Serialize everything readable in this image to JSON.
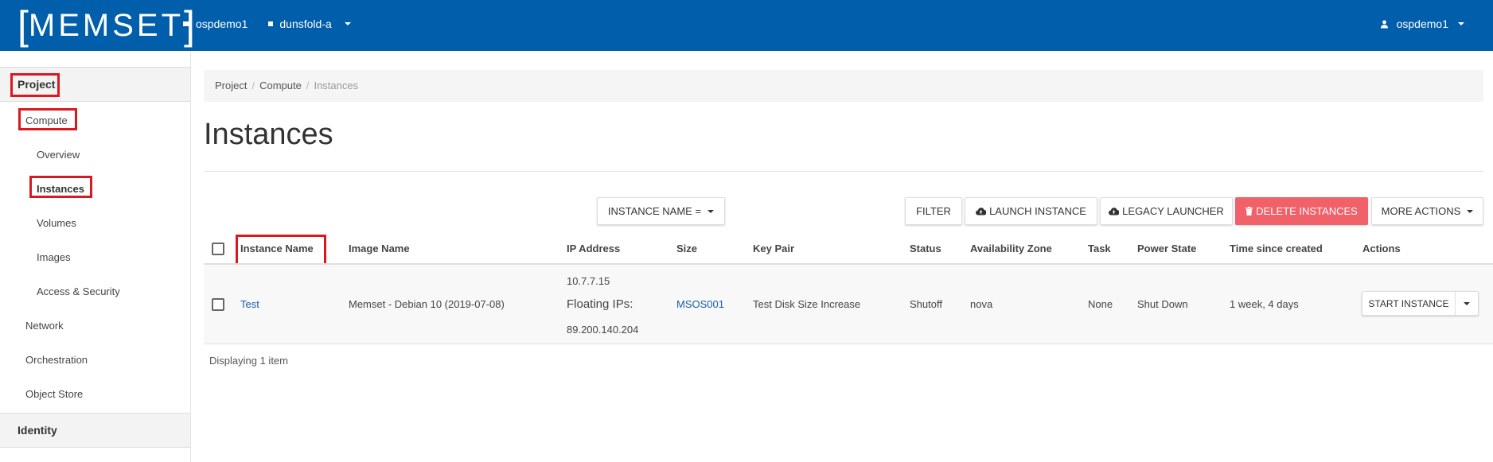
{
  "header": {
    "logo": "MEMSET",
    "project": "ospdemo1",
    "region": "dunsfold-a",
    "user": "ospdemo1"
  },
  "sidebar": {
    "project_label": "Project",
    "compute_label": "Compute",
    "compute_items": [
      "Overview",
      "Instances",
      "Volumes",
      "Images",
      "Access & Security"
    ],
    "other_items": [
      "Network",
      "Orchestration",
      "Object Store"
    ],
    "identity_label": "Identity"
  },
  "breadcrumb": [
    "Project",
    "Compute",
    "Instances"
  ],
  "page_title": "Instances",
  "toolbar": {
    "filter_select": "INSTANCE NAME =",
    "filter_button": "FILTER",
    "launch_button": "LAUNCH INSTANCE",
    "legacy_button": "LEGACY LAUNCHER",
    "delete_button": "DELETE INSTANCES",
    "more_actions": "MORE ACTIONS"
  },
  "table": {
    "columns": [
      "Instance Name",
      "Image Name",
      "IP Address",
      "Size",
      "Key Pair",
      "Status",
      "Availability Zone",
      "Task",
      "Power State",
      "Time since created",
      "Actions"
    ],
    "rows": [
      {
        "name": "Test",
        "image": "Memset - Debian 10 (2019-07-08)",
        "ip": "10.7.7.15",
        "floating_label": "Floating IPs:",
        "floating_ip": "89.200.140.204",
        "size": "MSOS001",
        "key_pair": "Test Disk Size Increase",
        "status": "Shutoff",
        "zone": "nova",
        "task": "None",
        "power": "Shut Down",
        "time": "1 week, 4 days",
        "action": "START INSTANCE"
      }
    ],
    "footer": "Displaying 1 item"
  },
  "colors": {
    "header_bg": "#005eaa",
    "danger": "#f0616a",
    "highlight": "#d9181f",
    "link": "#1a5ea8"
  }
}
